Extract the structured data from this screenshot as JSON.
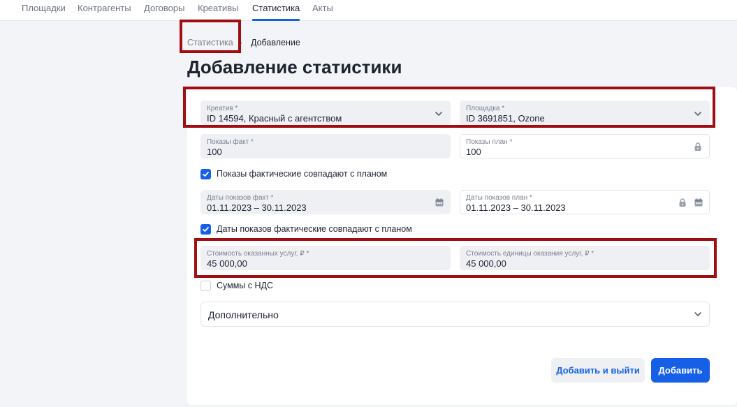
{
  "nav": {
    "items": [
      "Площадки",
      "Контрагенты",
      "Договоры",
      "Креативы",
      "Статистика",
      "Акты"
    ],
    "active_index": 4
  },
  "breadcrumb": {
    "parent": "Статистика",
    "current": "Добавление"
  },
  "page": {
    "title": "Добавление статистики"
  },
  "form": {
    "creative": {
      "label": "Креатив *",
      "value": "ID 14594, Красный с агентством"
    },
    "platform": {
      "label": "Площадка *",
      "value": "ID 3691851, Ozone"
    },
    "impressions_fact": {
      "label": "Показы факт *",
      "value": "100"
    },
    "impressions_plan": {
      "label": "Показы план *",
      "value": "100"
    },
    "impressions_match": {
      "label": "Показы фактические совпадают с планом",
      "checked": true
    },
    "dates_fact": {
      "label": "Даты показов факт *",
      "value": "01.11.2023 – 30.11.2023"
    },
    "dates_plan": {
      "label": "Даты показов план *",
      "value": "01.11.2023 – 30.11.2023"
    },
    "dates_match": {
      "label": "Даты показов фактические совпадают с планом",
      "checked": true
    },
    "service_cost": {
      "label": "Стоимость оказанных услуг, ₽ *",
      "value": "45 000,00"
    },
    "unit_cost": {
      "label": "Стоимость единицы оказания услуг, ₽ *",
      "value": "45 000,00"
    },
    "vat": {
      "label": "Суммы с НДС",
      "checked": false
    },
    "additional": {
      "label": "Дополнительно"
    }
  },
  "actions": {
    "add_and_exit": "Добавить и выйти",
    "add": "Добавить"
  },
  "icons": {
    "dropdown": "chevron-down-icon",
    "lock": "lock-icon",
    "calendar": "calendar-icon",
    "check": "check-icon"
  },
  "colors": {
    "accent": "#1560e6",
    "highlight": "#a00d12",
    "field_bg": "#eef0f4"
  }
}
